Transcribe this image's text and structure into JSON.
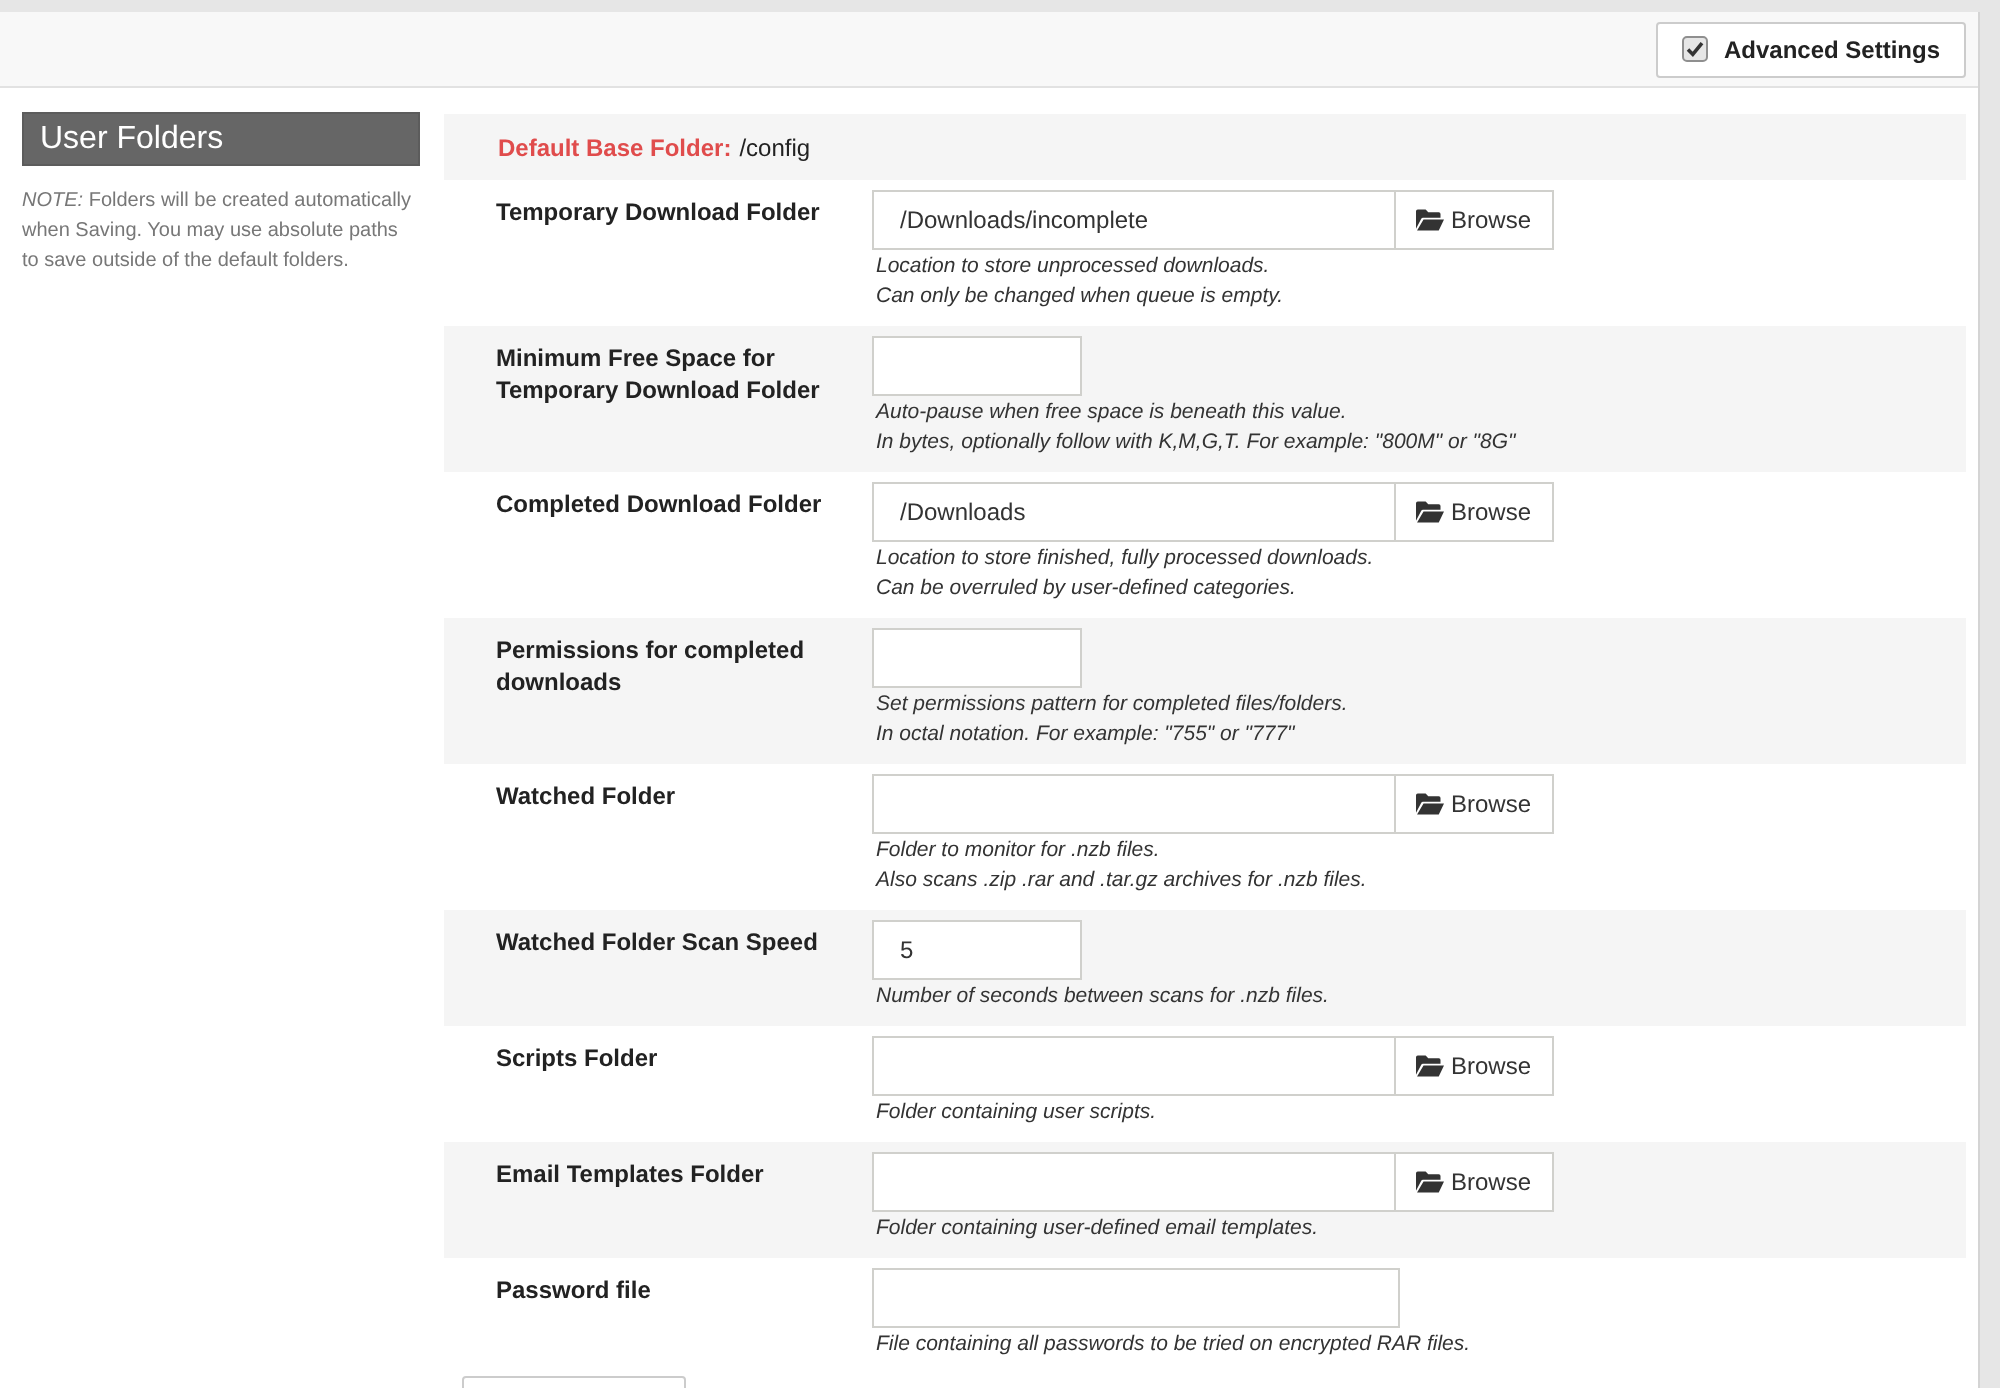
{
  "header": {
    "advanced_settings": {
      "label": "Advanced Settings",
      "checked": true
    }
  },
  "sidebar": {
    "title": "User Folders",
    "note": "*NOTE:* Folders will be created automatically when Saving. You may use absolute paths to save outside of the default folders."
  },
  "base_folder": {
    "label": "Default Base Folder:",
    "value": "/config"
  },
  "fields": [
    {
      "kind": "browse",
      "label": "Temporary Download Folder",
      "value": "/Downloads/incomplete",
      "browse": "Browse",
      "help": [
        "Location to store unprocessed downloads.",
        "Can only be changed when queue is empty."
      ]
    },
    {
      "kind": "short",
      "label": "Minimum Free Space for Temporary Download Folder",
      "help": [
        "Auto-pause when free space is beneath this value.",
        "In bytes, optionally follow with K,M,G,T. For example: \"800M\" or \"8G\""
      ]
    },
    {
      "kind": "browse",
      "label": "Completed Download Folder",
      "value": "/Downloads",
      "browse": "Browse",
      "help": [
        "Location to store finished, fully processed downloads.",
        "Can be overruled by user-defined categories."
      ]
    },
    {
      "kind": "short",
      "label": "Permissions for completed downloads",
      "help": [
        "Set permissions pattern for completed files/folders.",
        "In octal notation. For example: \"755\" or \"777\""
      ]
    },
    {
      "kind": "browse",
      "label": "Watched Folder",
      "browse": "Browse",
      "help": [
        "Folder to monitor for .nzb files.",
        "Also scans .zip .rar and .tar.gz archives for .nzb files."
      ]
    },
    {
      "kind": "short",
      "label": "Watched Folder Scan Speed",
      "value": "5",
      "help": [
        "Number of seconds between scans for .nzb files."
      ]
    },
    {
      "kind": "browse",
      "label": "Scripts Folder",
      "browse": "Browse",
      "help": [
        "Folder containing user scripts."
      ]
    },
    {
      "kind": "browse",
      "label": "Email Templates Folder",
      "browse": "Browse",
      "help": [
        "Folder containing user-defined email templates."
      ]
    },
    {
      "kind": "long",
      "label": "Password file",
      "help": [
        "File containing all passwords to be tried on encrypted RAR files."
      ]
    }
  ]
}
